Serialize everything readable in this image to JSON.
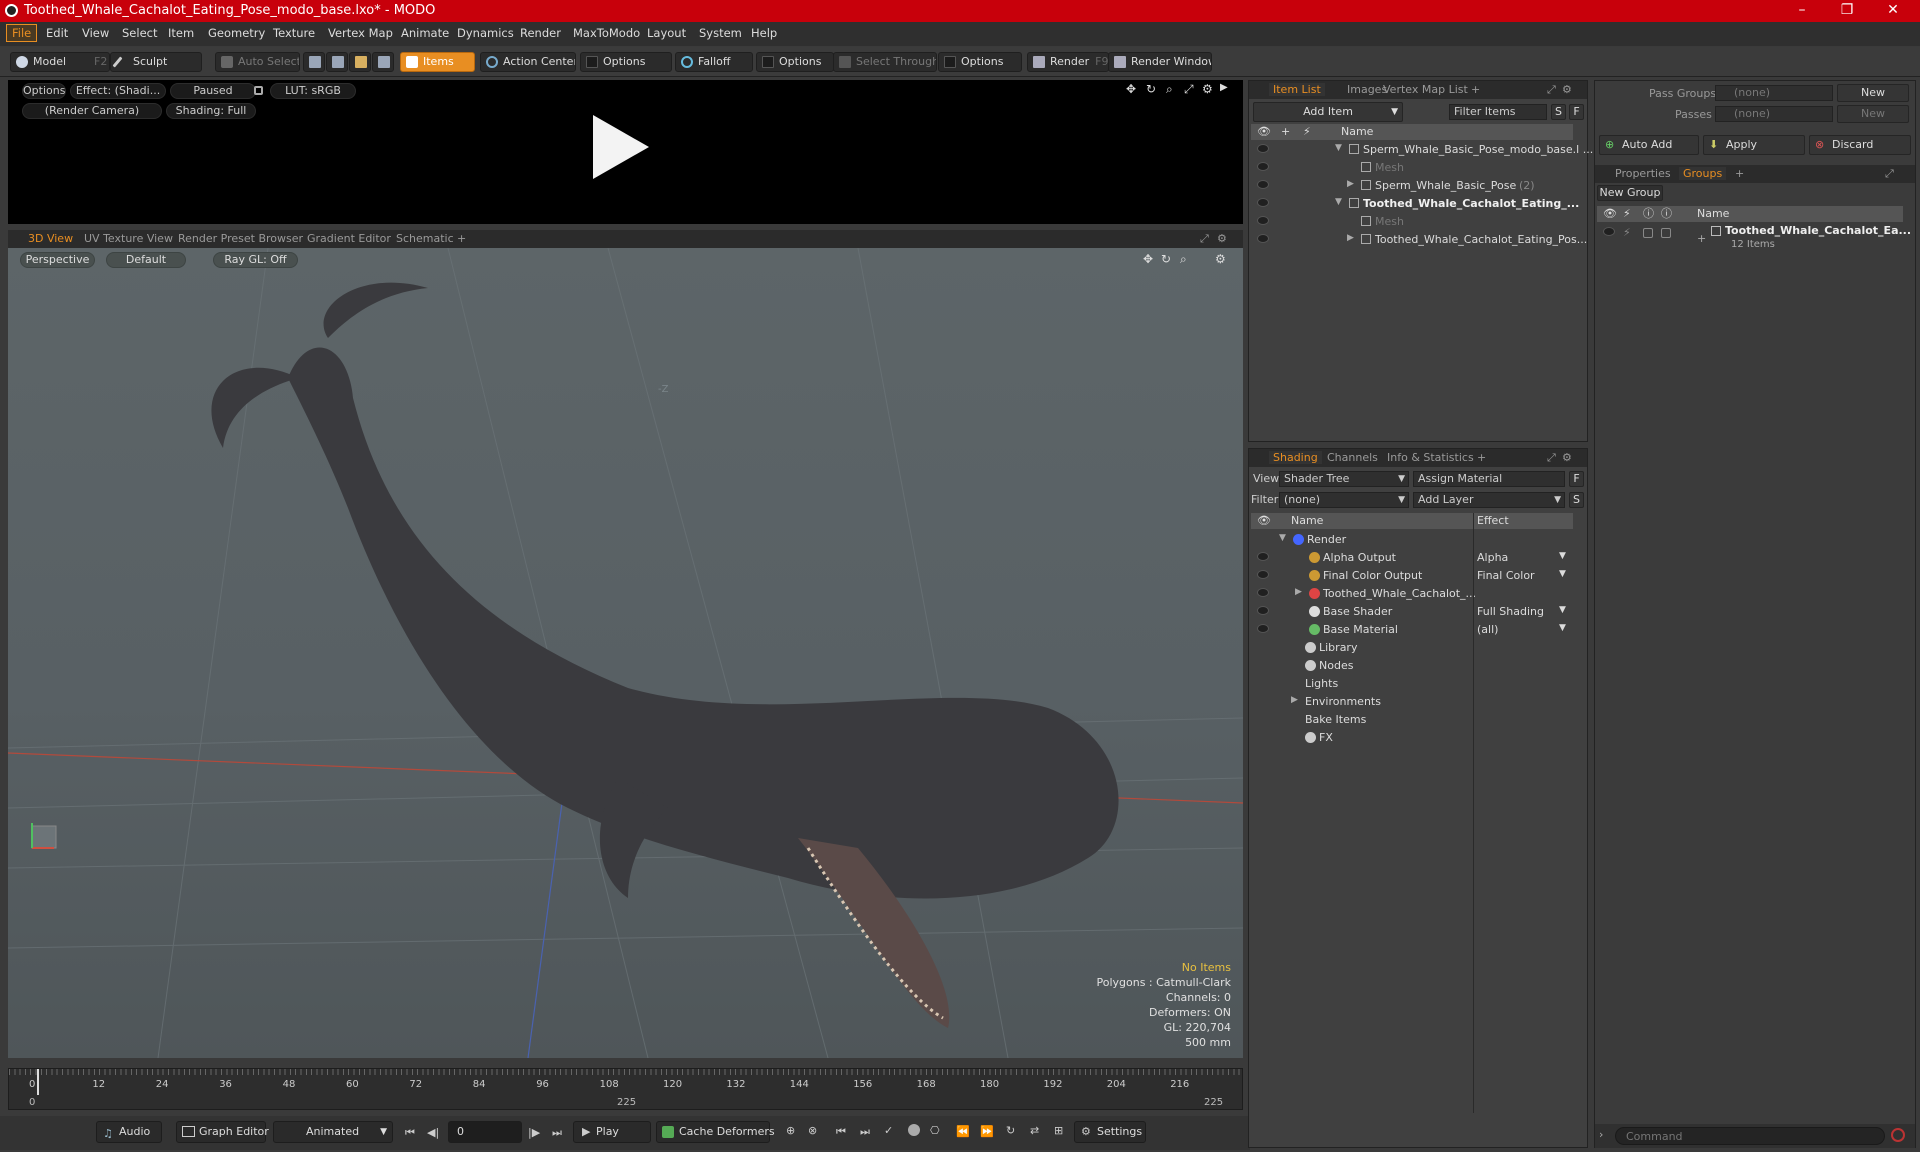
{
  "window": {
    "title": "Toothed_Whale_Cachalot_Eating_Pose_modo_base.lxo* - MODO",
    "minimize": "–",
    "maximize": "❐",
    "close": "✕"
  },
  "menu": [
    "File",
    "Edit",
    "View",
    "Select",
    "Item",
    "Geometry",
    "Texture",
    "Vertex Map",
    "Animate",
    "Dynamics",
    "Render",
    "MaxToModo",
    "Layout",
    "System",
    "Help"
  ],
  "toolbar": {
    "model": "Model",
    "model_key": "F2",
    "sculpt": "Sculpt",
    "auto_select": "Auto Select",
    "items": "Items",
    "action_center": "Action Center",
    "options1": "Options",
    "falloff": "Falloff",
    "options2": "Options",
    "select_through": "Select Through",
    "options3": "Options",
    "render": "Render",
    "render_key": "F9",
    "render_window": "Render Window"
  },
  "preview": {
    "options": "Options",
    "effect": "Effect: (Shadi...",
    "paused": "Paused",
    "lut": "LUT: sRGB",
    "camera": "(Render Camera)",
    "shading": "Shading: Full"
  },
  "view_tabs": [
    "3D View",
    "UV Texture View",
    "Render Preset Browser",
    "Gradient Editor",
    "Schematic",
    "+"
  ],
  "viewport": {
    "perspective": "Perspective",
    "default": "Default",
    "raygl": "Ray GL: Off",
    "axis_label": "-Z",
    "stats": {
      "items": "No Items",
      "polygons": "Polygons : Catmull-Clark",
      "channels": "Channels: 0",
      "deformers": "Deformers: ON",
      "gl": "GL: 220,704",
      "scale": "500 mm"
    }
  },
  "timeline": {
    "ticks": [
      "0",
      "12",
      "24",
      "36",
      "48",
      "60",
      "72",
      "84",
      "96",
      "108",
      "120",
      "132",
      "144",
      "156",
      "168",
      "180",
      "192",
      "204",
      "216"
    ],
    "range_start": "0",
    "range_mid": "225",
    "range_end": "225"
  },
  "bottom": {
    "audio": "Audio",
    "graph_editor": "Graph Editor",
    "animated": "Animated",
    "frame": "0",
    "play": "Play",
    "cache": "Cache Deformers",
    "settings": "Settings"
  },
  "item_list": {
    "tabs": [
      "Item List",
      "Images",
      "Vertex Map List",
      "+"
    ],
    "add_item": "Add Item",
    "filter_items": "Filter Items",
    "s": "S",
    "f": "F",
    "col_name": "Name",
    "rows": [
      {
        "label": "Sperm_Whale_Basic_Pose_modo_base.l ...",
        "indent": 0,
        "bold": false,
        "dim": false
      },
      {
        "label": "Mesh",
        "indent": 1,
        "bold": false,
        "dim": true
      },
      {
        "label": "Sperm_Whale_Basic_Pose",
        "suffix": "(2)",
        "indent": 1,
        "bold": false,
        "dim": false
      },
      {
        "label": "Toothed_Whale_Cachalot_Eating_...",
        "indent": 0,
        "bold": true,
        "dim": false
      },
      {
        "label": "Mesh",
        "indent": 1,
        "bold": false,
        "dim": true
      },
      {
        "label": "Toothed_Whale_Cachalot_Eating_Pos...",
        "indent": 1,
        "bold": false,
        "dim": false
      }
    ]
  },
  "shading": {
    "tabs": [
      "Shading",
      "Channels",
      "Info & Statistics",
      "+"
    ],
    "view_label": "View",
    "view_value": "Shader Tree",
    "assign_material": "Assign Material",
    "filter_label": "Filter",
    "filter_value": "(none)",
    "add_layer": "Add Layer",
    "f": "F",
    "s": "S",
    "col_name": "Name",
    "col_effect": "Effect",
    "rows": [
      {
        "name": "Render",
        "effect": "",
        "eye": false
      },
      {
        "name": "Alpha Output",
        "effect": "Alpha",
        "eye": true
      },
      {
        "name": "Final Color Output",
        "effect": "Final Color",
        "eye": true
      },
      {
        "name": "Toothed_Whale_Cachalot_...",
        "effect": "",
        "eye": true
      },
      {
        "name": "Base Shader",
        "effect": "Full Shading",
        "eye": true
      },
      {
        "name": "Base Material",
        "effect": "(all)",
        "eye": true
      },
      {
        "name": "Library",
        "effect": "",
        "eye": false
      },
      {
        "name": "Nodes",
        "effect": "",
        "eye": false
      },
      {
        "name": "Lights",
        "effect": "",
        "eye": false
      },
      {
        "name": "Environments",
        "effect": "",
        "eye": false
      },
      {
        "name": "Bake Items",
        "effect": "",
        "eye": false
      },
      {
        "name": "FX",
        "effect": "",
        "eye": false
      }
    ]
  },
  "groups": {
    "pass_groups_label": "Pass Groups",
    "pass_groups_value": "(none)",
    "passes_label": "Passes",
    "passes_value": "(none)",
    "new1": "New",
    "new2": "New",
    "auto_add": "Auto Add",
    "apply": "Apply",
    "discard": "Discard",
    "tabs": [
      "Properties",
      "Groups",
      "+"
    ],
    "new_group": "New Group",
    "col_name": "Name",
    "group_name": "Toothed_Whale_Cachalot_Ea...",
    "group_count": "12 Items",
    "command_placeholder": "Command"
  },
  "colors": {
    "accent": "#e88e22",
    "title_red": "#c8000b"
  }
}
